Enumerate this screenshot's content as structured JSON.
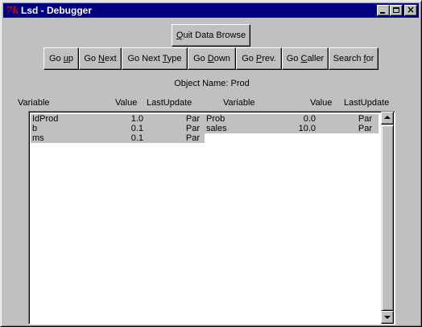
{
  "window": {
    "title": "Lsd - Debugger",
    "icon_text": "7k"
  },
  "buttons": {
    "quit": {
      "pre": "",
      "key": "Q",
      "post": "uit Data Browse"
    },
    "go_up": {
      "pre": "Go ",
      "key": "u",
      "post": "p"
    },
    "go_next": {
      "pre": "Go ",
      "key": "N",
      "post": "ext"
    },
    "go_next_type": {
      "pre": "Go Next ",
      "key": "T",
      "post": "ype"
    },
    "go_down": {
      "pre": "Go ",
      "key": "D",
      "post": "own"
    },
    "go_prev": {
      "pre": "Go ",
      "key": "P",
      "post": "rev."
    },
    "go_caller": {
      "pre": "Go ",
      "key": "C",
      "post": "aller"
    },
    "search_for": {
      "pre": "Search ",
      "key": "f",
      "post": "or"
    }
  },
  "object_name": "Object Name: Prod",
  "columns": {
    "left": {
      "variable": "Variable",
      "value": "Value",
      "last_update": "LastUpdate"
    },
    "right": {
      "variable": "Variable",
      "value": "Value",
      "last_update": "LastUpdate"
    }
  },
  "rows_left": [
    {
      "variable": "IdProd",
      "value": "1.0",
      "last_update": "Par"
    },
    {
      "variable": "b",
      "value": "0.1",
      "last_update": "Par"
    },
    {
      "variable": "ms",
      "value": "0.1",
      "last_update": "Par"
    }
  ],
  "rows_right": [
    {
      "variable": "Prob",
      "value": "0.0",
      "last_update": "Par"
    },
    {
      "variable": "sales",
      "value": "10.0",
      "last_update": "Par"
    }
  ],
  "colors": {
    "titlebar": "#000080",
    "face": "#c0c0c0",
    "list_background": "#ffffff"
  }
}
